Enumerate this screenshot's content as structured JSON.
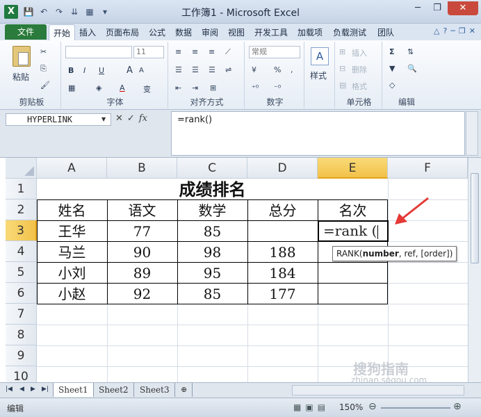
{
  "window": {
    "title": "工作簿1 - Microsoft Excel",
    "app_icon": "X",
    "controls": [
      "─",
      "❐",
      "✕"
    ]
  },
  "quick_access": [
    "💾",
    "↶",
    "↷",
    "⇊",
    "▦",
    "▾"
  ],
  "tabs": {
    "file": "文件",
    "items": [
      "开始",
      "插入",
      "页面布局",
      "公式",
      "数据",
      "审阅",
      "视图",
      "开发工具",
      "加载项",
      "负载测试",
      "团队"
    ],
    "active": "开始",
    "right_icons": [
      "△",
      "?",
      "─",
      "❐",
      "✕"
    ]
  },
  "ribbon": {
    "clipboard": {
      "label": "剪贴板",
      "paste": "粘贴"
    },
    "font": {
      "label": "字体",
      "size": "11",
      "bold": "B",
      "italic": "I",
      "underline": "U",
      "grow": "A",
      "shrink": "A",
      "change": "变"
    },
    "alignment": {
      "label": "对齐方式"
    },
    "number": {
      "label": "数字",
      "format": "常规",
      "percent": "%",
      "comma": ","
    },
    "styles": {
      "label": "样式",
      "icon": "A"
    },
    "cells": {
      "label": "单元格",
      "insert": "插入",
      "delete": "删除",
      "format": "格式"
    },
    "editing": {
      "label": "编辑",
      "sum": "Σ"
    }
  },
  "formula_bar": {
    "name_box": "HYPERLINK",
    "formula": "=rank()",
    "cancel": "✕",
    "enter": "✓",
    "fx": "fx"
  },
  "grid": {
    "columns": [
      "A",
      "B",
      "C",
      "D",
      "E",
      "F"
    ],
    "rows": [
      "1",
      "2",
      "3",
      "4",
      "5",
      "6",
      "7",
      "8",
      "9",
      "10"
    ],
    "selected_column": "E",
    "selected_row": "3",
    "title": "成绩排名",
    "headers": [
      "姓名",
      "语文",
      "数学",
      "总分",
      "名次"
    ],
    "data": [
      [
        "王华",
        "77",
        "85",
        ""
      ],
      [
        "马兰",
        "90",
        "98",
        "188"
      ],
      [
        "小刘",
        "89",
        "95",
        "184"
      ],
      [
        "小赵",
        "92",
        "85",
        "177"
      ]
    ],
    "active_cell_text": "=rank (",
    "tooltip": {
      "prefix": "RANK(",
      "bold": "number",
      "suffix": ", ref, [order])"
    }
  },
  "watermark": {
    "brand": "搜狗指南",
    "url": "zhinan.sogou.com"
  },
  "sheet_tabs": [
    "Sheet1",
    "Sheet2",
    "Sheet3"
  ],
  "sheet_active": "Sheet1",
  "status_bar": {
    "mode": "编辑",
    "zoom": "150%"
  },
  "colors": {
    "file_tab": "#2a7b3c",
    "selected_header": "#f2c24a",
    "arrow": "#e53935"
  }
}
